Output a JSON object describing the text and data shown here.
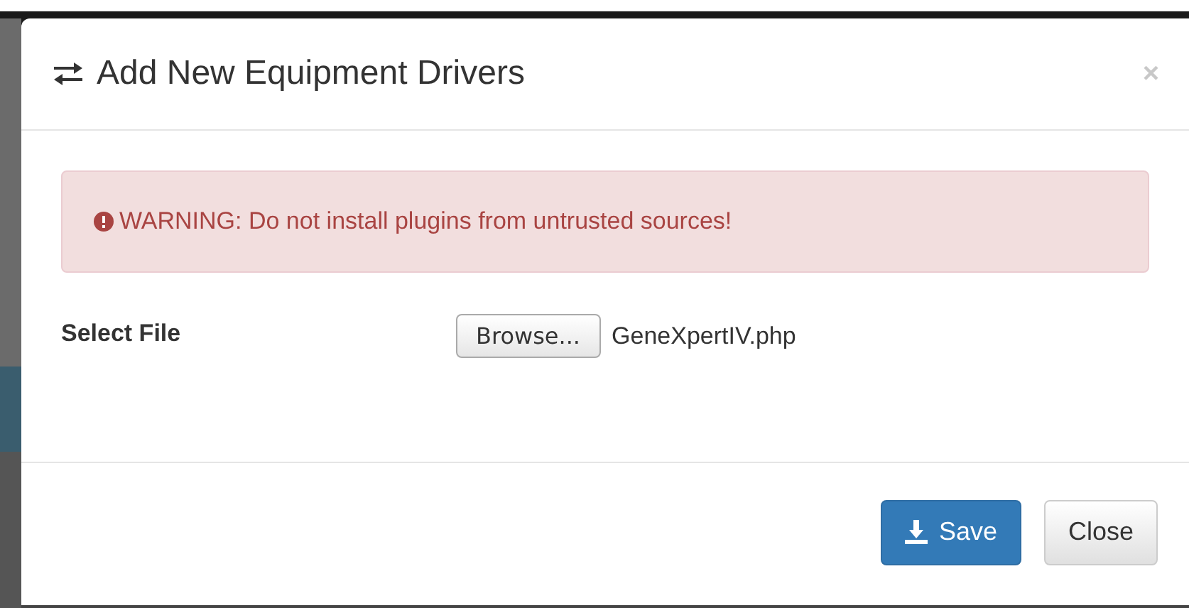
{
  "modal": {
    "title": "Add New Equipment Drivers",
    "close": "×"
  },
  "alert": {
    "text": "WARNING: Do not install plugins from untrusted sources!"
  },
  "file_field": {
    "label": "Select File",
    "button": "Browse...",
    "value": "GeneXpertIV.php"
  },
  "buttons": [
    {
      "kind": "primary",
      "label": "Save"
    },
    {
      "kind": "default",
      "label": "Close"
    }
  ]
}
